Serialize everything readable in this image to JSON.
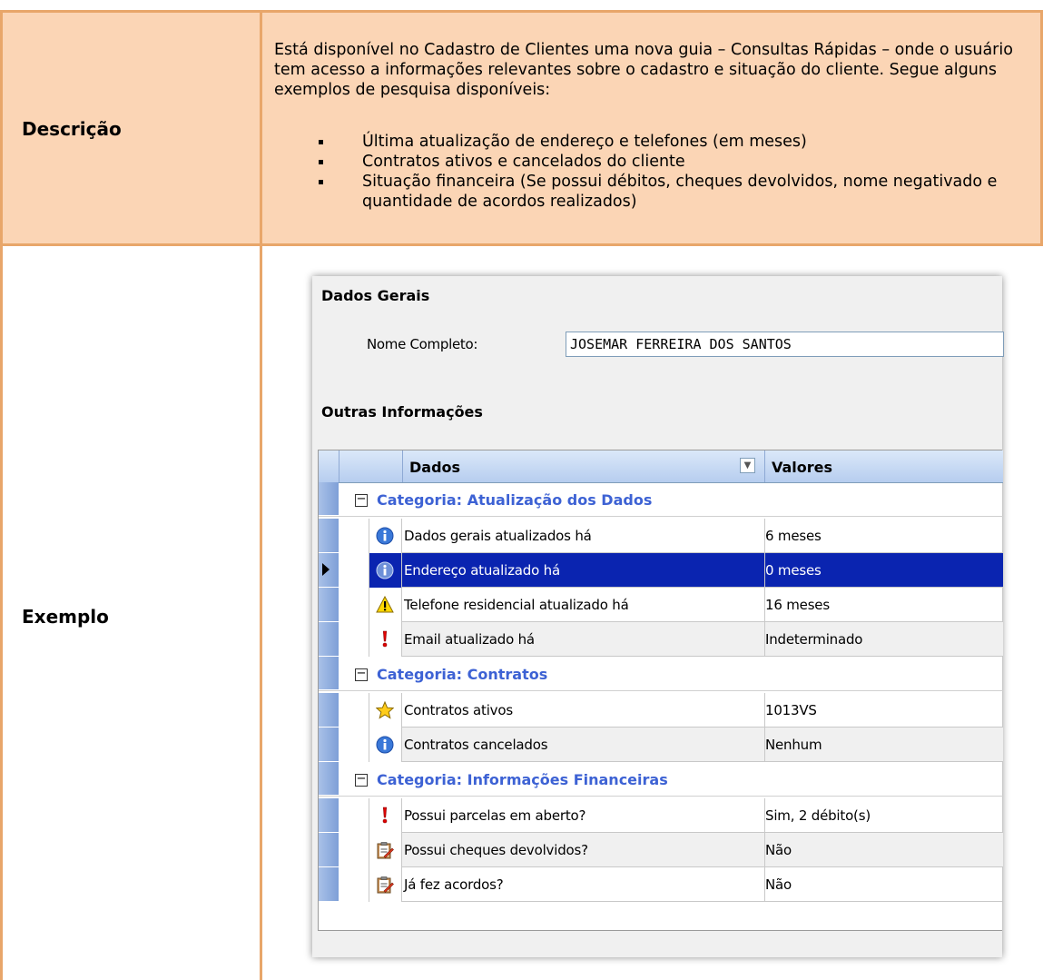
{
  "doc": {
    "descricao_label": "Descrição",
    "exemplo_label": "Exemplo",
    "description": "Está disponível no Cadastro de Clientes uma nova guia – Consultas Rápidas – onde o usuário tem acesso a informações relevantes sobre o cadastro e situação do cliente. Segue alguns exemplos de pesquisa disponíveis:",
    "bullets": [
      "Última atualização de endereço e telefones (em meses)",
      "Contratos ativos e cancelados do cliente",
      "Situação financeira (Se possui débitos, cheques devolvidos, nome negativado e quantidade de acordos realizados)"
    ]
  },
  "window": {
    "section1": "Dados Gerais",
    "nome_label": "Nome Completo:",
    "nome_value": "JOSEMAR FERREIRA DOS SANTOS",
    "section2": "Outras Informações",
    "grid": {
      "col_dados": "Dados",
      "col_valores": "Valores",
      "categories": [
        {
          "title": "Categoria: Atualização dos Dados",
          "rows": [
            {
              "icon": "info-icon",
              "dado": "Dados gerais atualizados há",
              "valor": "6 meses"
            },
            {
              "icon": "info-icon",
              "dado": "Endereço atualizado há",
              "valor": "0 meses",
              "selected": true
            },
            {
              "icon": "warning-icon",
              "dado": "Telefone residencial atualizado há",
              "valor": "16 meses"
            },
            {
              "icon": "exclamation-icon",
              "dado": "Email atualizado há",
              "valor": "Indeterminado"
            }
          ]
        },
        {
          "title": "Categoria: Contratos",
          "rows": [
            {
              "icon": "star-icon",
              "dado": "Contratos ativos",
              "valor": "1013VS"
            },
            {
              "icon": "info-icon",
              "dado": "Contratos cancelados",
              "valor": "Nenhum"
            }
          ]
        },
        {
          "title": "Categoria: Informações Financeiras",
          "rows": [
            {
              "icon": "exclamation-icon",
              "dado": "Possui parcelas em aberto?",
              "valor": "Sim, 2 débito(s)"
            },
            {
              "icon": "clipboard-icon",
              "dado": "Possui cheques devolvidos?",
              "valor": "Não"
            },
            {
              "icon": "clipboard-icon",
              "dado": "Já fez acordos?",
              "valor": "Não"
            }
          ]
        }
      ]
    }
  },
  "colors": {
    "border": "#e8a66a",
    "desc_bg": "#fbd5b5",
    "category_text": "#3d62d4",
    "selection": "#0a24b0"
  }
}
